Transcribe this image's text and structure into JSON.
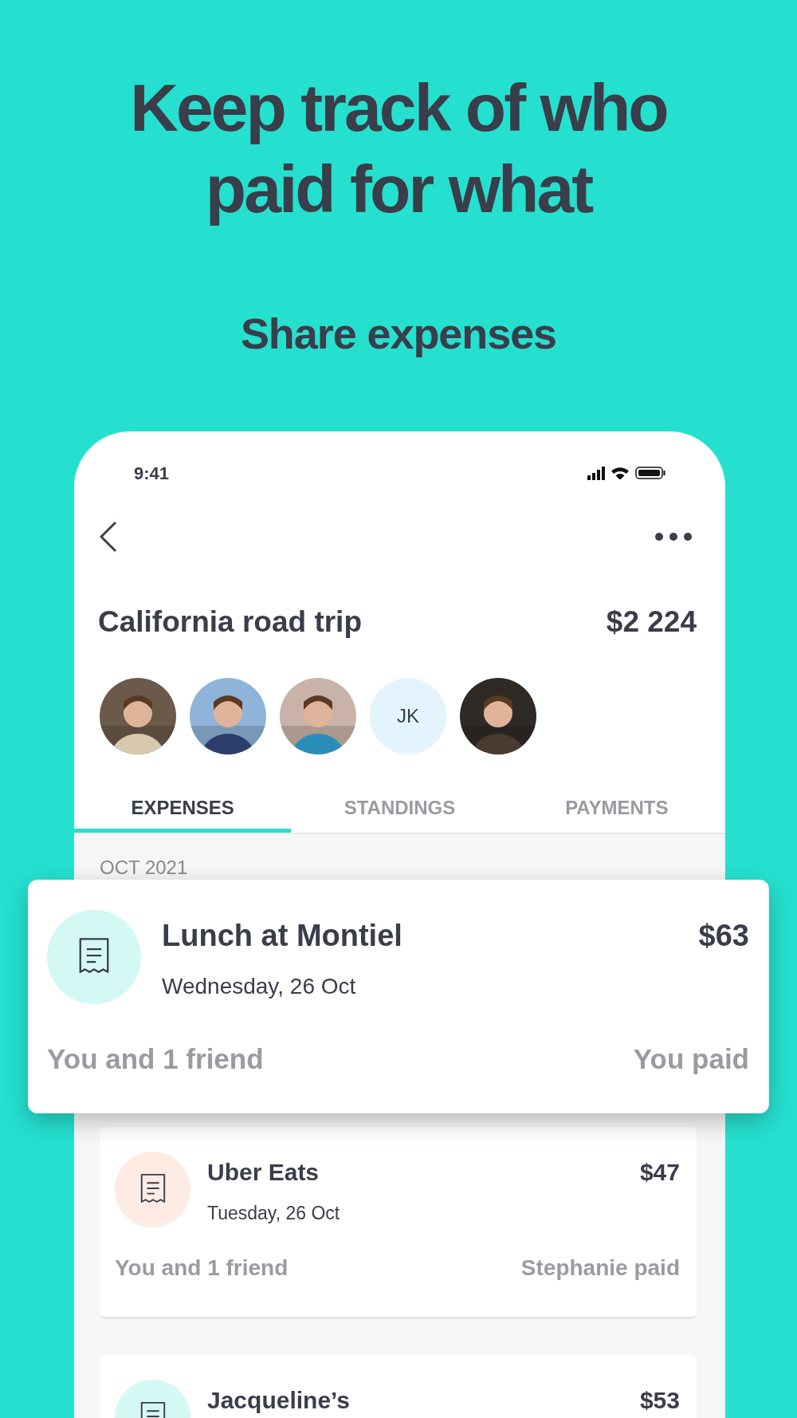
{
  "headline": "Keep track of who paid for what",
  "subheadline": "Share expenses",
  "status_bar": {
    "time": "9:41"
  },
  "group": {
    "title": "California road trip",
    "total": "$2 224"
  },
  "members": [
    {
      "kind": "picture"
    },
    {
      "kind": "picture"
    },
    {
      "kind": "picture"
    },
    {
      "kind": "initials",
      "initials": "JK"
    },
    {
      "kind": "picture"
    }
  ],
  "tabs": [
    {
      "label": "EXPENSES",
      "selected": true
    },
    {
      "label": "STANDINGS",
      "selected": false
    },
    {
      "label": "PAYMENTS",
      "selected": false
    }
  ],
  "section": "OCT 2021",
  "expenses": [
    {
      "title": "Lunch at Montiel",
      "date": "Wednesday, 26 Oct",
      "amount": "$63",
      "shared": "You and 1 friend",
      "payer": "You paid",
      "color": "#d4f8f4",
      "highlighted": true
    },
    {
      "title": "Uber Eats",
      "date": "Tuesday, 26 Oct",
      "amount": "$47",
      "shared": "You and 1 friend",
      "payer": "Stephanie paid",
      "color": "#fdebe4",
      "highlighted": false
    },
    {
      "title": "Jacqueline’s",
      "amount": "$53",
      "color": "#d4f8f4",
      "highlighted": false
    }
  ]
}
